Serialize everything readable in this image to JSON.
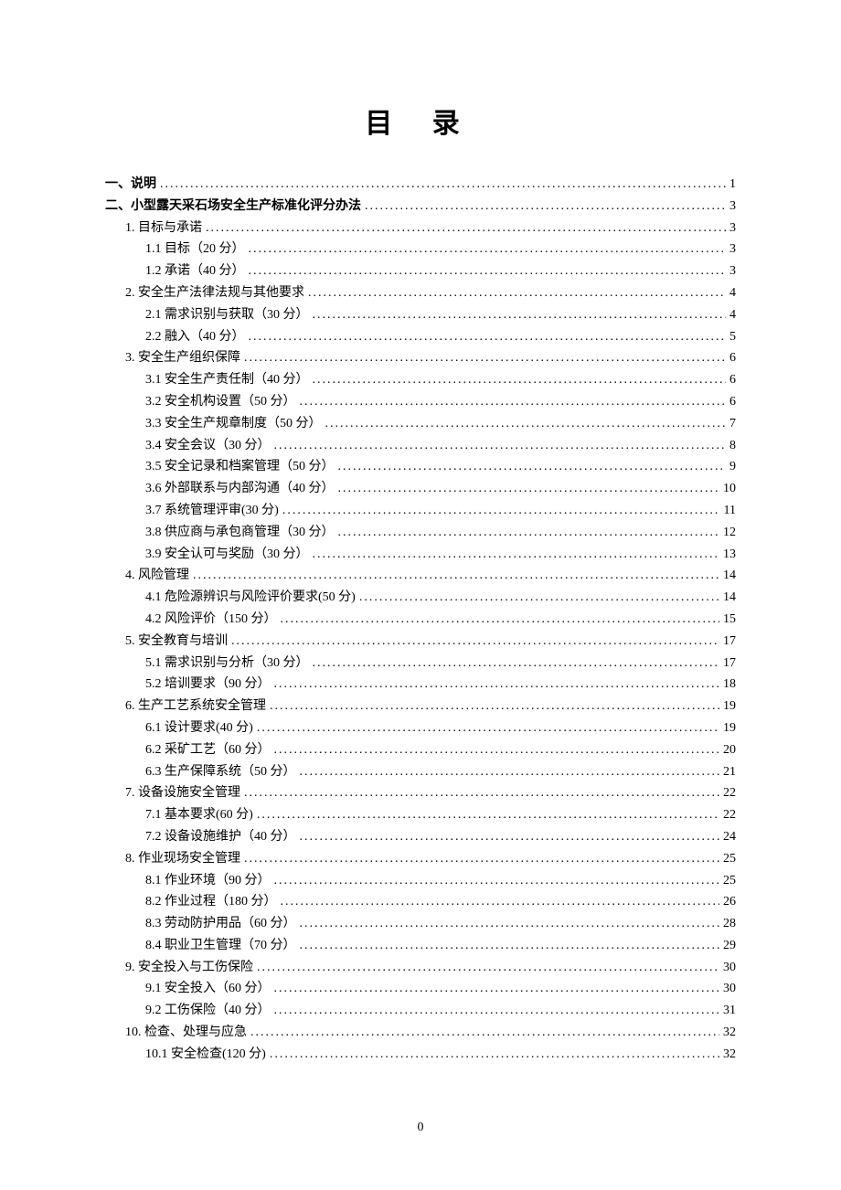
{
  "title": "目 录",
  "footer_page": "0",
  "toc": [
    {
      "level": 1,
      "label": "一、说明",
      "page": "1"
    },
    {
      "level": 1,
      "label": "二、小型露天采石场安全生产标准化评分办法",
      "page": "3"
    },
    {
      "level": 2,
      "label": "1. 目标与承诺",
      "page": "3"
    },
    {
      "level": 3,
      "label": "1.1 目标（20 分）",
      "page": "3"
    },
    {
      "level": 3,
      "label": "1.2 承诺（40 分）",
      "page": "3"
    },
    {
      "level": 2,
      "label": "2. 安全生产法律法规与其他要求",
      "page": "4"
    },
    {
      "level": 3,
      "label": "2.1 需求识别与获取（30 分）",
      "page": "4"
    },
    {
      "level": 3,
      "label": "2.2 融入（40 分）",
      "page": "5"
    },
    {
      "level": 2,
      "label": "3. 安全生产组织保障",
      "page": "6"
    },
    {
      "level": 3,
      "label": "3.1 安全生产责任制（40 分）",
      "page": "6"
    },
    {
      "level": 3,
      "label": "3.2 安全机构设置（50 分）",
      "page": "6"
    },
    {
      "level": 3,
      "label": "3.3 安全生产规章制度（50 分）",
      "page": "7"
    },
    {
      "level": 3,
      "label": "3.4 安全会议（30 分）",
      "page": "8"
    },
    {
      "level": 3,
      "label": "3.5 安全记录和档案管理（50 分）",
      "page": "9"
    },
    {
      "level": 3,
      "label": "3.6 外部联系与内部沟通（40 分）",
      "page": "10"
    },
    {
      "level": 3,
      "label": "3.7 系统管理评审(30 分)",
      "page": "11"
    },
    {
      "level": 3,
      "label": "3.8 供应商与承包商管理（30 分）",
      "page": "12"
    },
    {
      "level": 3,
      "label": "3.9 安全认可与奖励（30 分）",
      "page": "13"
    },
    {
      "level": 2,
      "label": "4. 风险管理",
      "page": "14"
    },
    {
      "level": 3,
      "label": "4.1 危险源辨识与风险评价要求(50 分)",
      "page": "14"
    },
    {
      "level": 3,
      "label": "4.2 风险评价（150 分）",
      "page": "15"
    },
    {
      "level": 2,
      "label": "5. 安全教育与培训",
      "page": "17"
    },
    {
      "level": 3,
      "label": "5.1 需求识别与分析（30 分）",
      "page": "17"
    },
    {
      "level": 3,
      "label": "5.2 培训要求（90 分）",
      "page": "18"
    },
    {
      "level": 2,
      "label": "6. 生产工艺系统安全管理",
      "page": "19"
    },
    {
      "level": 3,
      "label": "6.1 设计要求(40 分)",
      "page": "19"
    },
    {
      "level": 3,
      "label": "6.2 采矿工艺（60 分）",
      "page": "20"
    },
    {
      "level": 3,
      "label": "6.3 生产保障系统（50 分）",
      "page": "21"
    },
    {
      "level": 2,
      "label": "7. 设备设施安全管理",
      "page": "22"
    },
    {
      "level": 3,
      "label": "7.1 基本要求(60 分)",
      "page": "22"
    },
    {
      "level": 3,
      "label": "7.2 设备设施维护（40 分）",
      "page": "24"
    },
    {
      "level": 2,
      "label": "8. 作业现场安全管理",
      "page": "25"
    },
    {
      "level": 3,
      "label": "8.1 作业环境（90 分）",
      "page": "25"
    },
    {
      "level": 3,
      "label": "8.2 作业过程（180 分）",
      "page": "26"
    },
    {
      "level": 3,
      "label": "8.3 劳动防护用品（60 分）",
      "page": "28"
    },
    {
      "level": 3,
      "label": "8.4 职业卫生管理（70 分）",
      "page": "29"
    },
    {
      "level": 2,
      "label": "9. 安全投入与工伤保险",
      "page": "30"
    },
    {
      "level": 3,
      "label": "9.1 安全投入（60 分）",
      "page": "30"
    },
    {
      "level": 3,
      "label": "9.2 工伤保险（40 分）",
      "page": "31"
    },
    {
      "level": 2,
      "label": "10. 检查、处理与应急",
      "page": "32"
    },
    {
      "level": 3,
      "label": "10.1  安全检查(120 分)",
      "page": "32"
    }
  ]
}
